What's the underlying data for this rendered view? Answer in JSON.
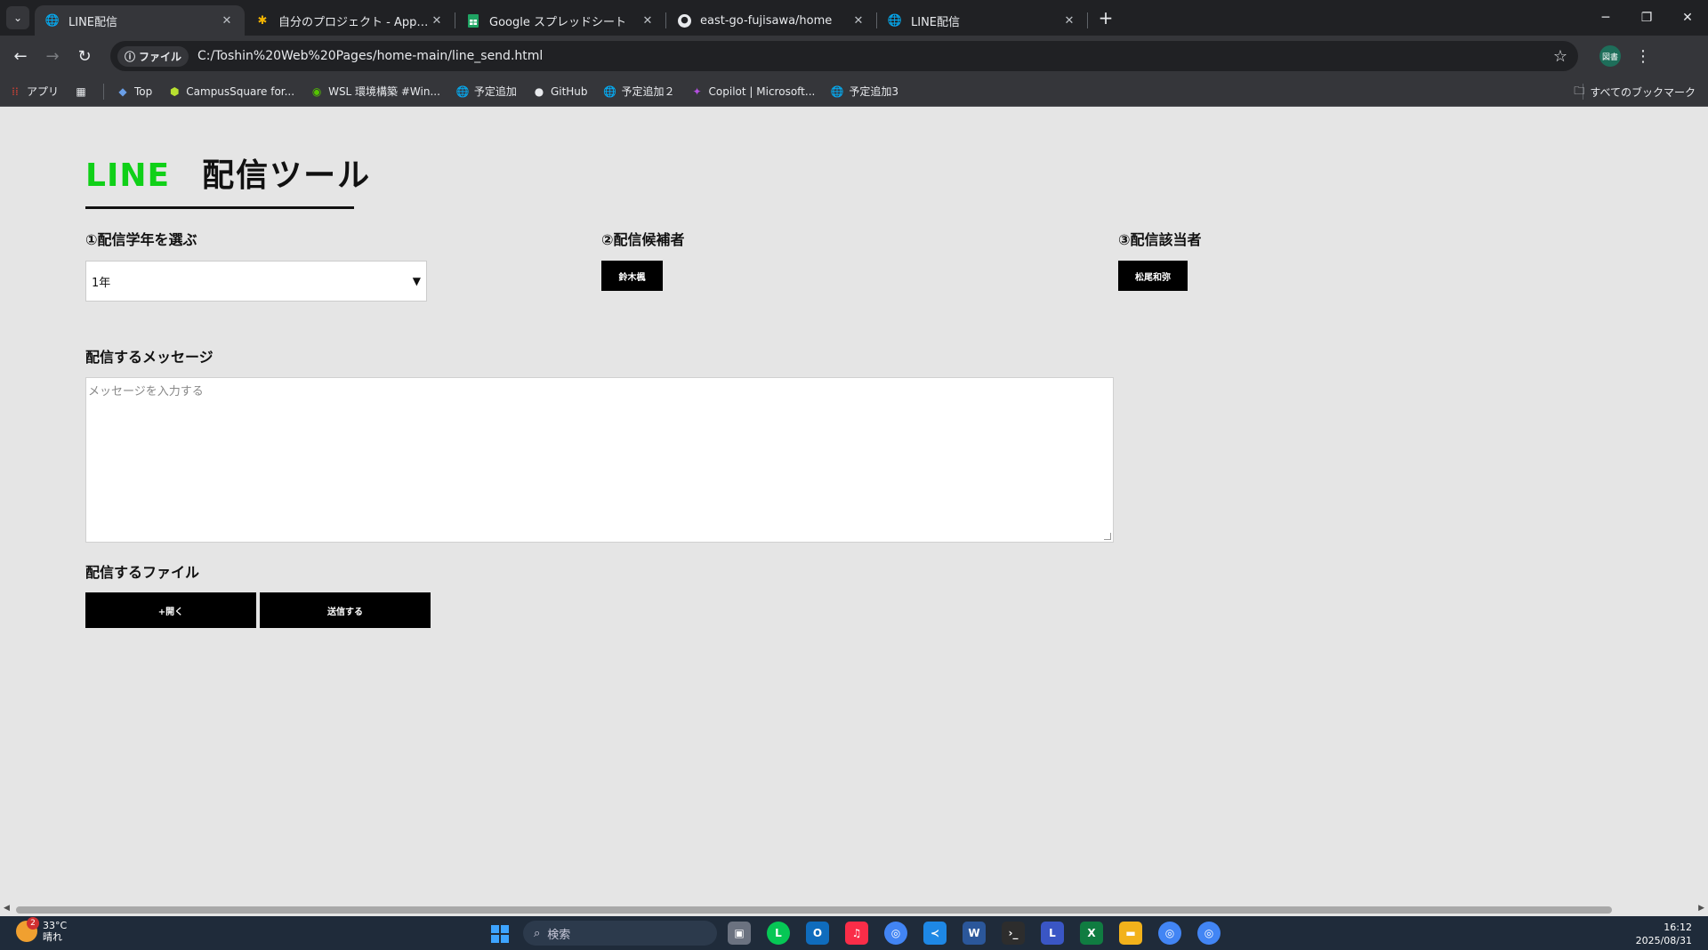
{
  "browser": {
    "tabs": [
      {
        "title": "LINE配信",
        "active": true,
        "icon": "globe-icon"
      },
      {
        "title": "自分のプロジェクト - Apps Script",
        "active": false,
        "icon": "apps-script-icon"
      },
      {
        "title": "Google スプレッドシート",
        "active": false,
        "icon": "sheets-icon"
      },
      {
        "title": "east-go-fujisawa/home",
        "active": false,
        "icon": "github-icon"
      },
      {
        "title": "LINE配信",
        "active": false,
        "icon": "globe-icon"
      }
    ],
    "address": {
      "chip_label": "ファイル",
      "url": "C:/Toshin%20Web%20Pages/home-main/line_send.html"
    },
    "profile_label": "図書",
    "bookmarks": [
      {
        "label": "アプリ",
        "icon": "apps-grid-icon"
      },
      {
        "label": "",
        "icon": "tab-groups-icon"
      },
      {
        "label": "Top",
        "icon": "campus-icon"
      },
      {
        "label": "CampusSquare for...",
        "icon": "campussquare-icon"
      },
      {
        "label": "WSL 環境構築 #Win...",
        "icon": "qiita-icon"
      },
      {
        "label": "予定追加",
        "icon": "globe-icon"
      },
      {
        "label": "GitHub",
        "icon": "github-icon"
      },
      {
        "label": "予定追加２",
        "icon": "globe-icon"
      },
      {
        "label": "Copilot | Microsoft...",
        "icon": "copilot-icon"
      },
      {
        "label": "予定追加3",
        "icon": "globe-icon"
      }
    ],
    "all_bookmarks_label": "すべてのブックマーク"
  },
  "app": {
    "title_brand": "LINE",
    "title_rest": "配信ツール",
    "brand_color": "#10d018",
    "step1_label": "①配信学年を選ぶ",
    "grade_selected": "1年",
    "step2_label": "②配信候補者",
    "candidate_button": "鈴木楓",
    "step3_label": "③配信該当者",
    "target_button": "松尾和弥",
    "message_label": "配信するメッセージ",
    "message_placeholder": "メッセージを入力する",
    "file_label": "配信するファイル",
    "open_button": "+開く",
    "send_button": "送信する"
  },
  "taskbar": {
    "weather_temp": "33°C",
    "weather_desc": "晴れ",
    "weather_badge": "2",
    "search_placeholder": "検索",
    "time": "16:12",
    "date": "2025/08/31"
  }
}
